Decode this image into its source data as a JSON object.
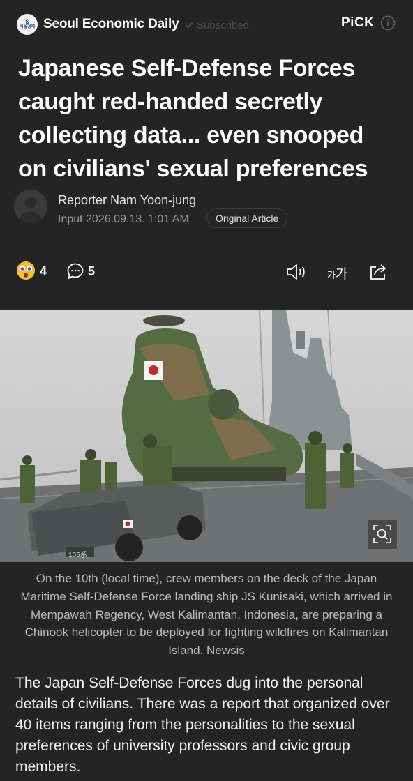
{
  "header": {
    "publisher_logo_text": "서울경제",
    "publisher": "Seoul Economic Daily",
    "subscribed_label": "Subscribed",
    "pick_label": "PiCK"
  },
  "article": {
    "headline": "Japanese Self-Defense Forces caught red-handed secretly collecting data... even snooped on civilians' sexual preferences",
    "reporter": "Reporter Nam Yoon-jung",
    "input_date": "Input 2026.09.13. 1:01 AM",
    "original_article_label": "Original Article",
    "caption": "On the 10th (local time), crew members on the deck of the Japan Maritime Self-Defense Force landing ship JS Kunisaki, which arrived in Mempawah Regency, West Kalimantan, Indonesia, are preparing a Chinook helicopter to be deployed for fighting wildfires on Kalimantan Island. Newsis",
    "body": "The Japan Self-Defense Forces dug into the personal details of civilians. There was a report that organized over 40 items ranging from the personalities to the sexual preferences of university professors and civic group members."
  },
  "actions": {
    "reaction_count": "4",
    "comment_count": "5",
    "font_size_small": "가",
    "font_size_large": "가"
  },
  "photo": {
    "vehicle_plate": "105系"
  },
  "icons": {
    "reaction": "astonished-face-icon",
    "comment": "comment-bubble-icon",
    "speaker": "speaker-icon",
    "share": "share-icon",
    "zoom": "zoom-image-icon",
    "info": "info-icon",
    "verified": "check-icon"
  },
  "colors": {
    "background": "#242424",
    "text_primary": "#ffffff",
    "text_secondary": "#9a9a9a",
    "subscribed": "#4d4d4d"
  }
}
